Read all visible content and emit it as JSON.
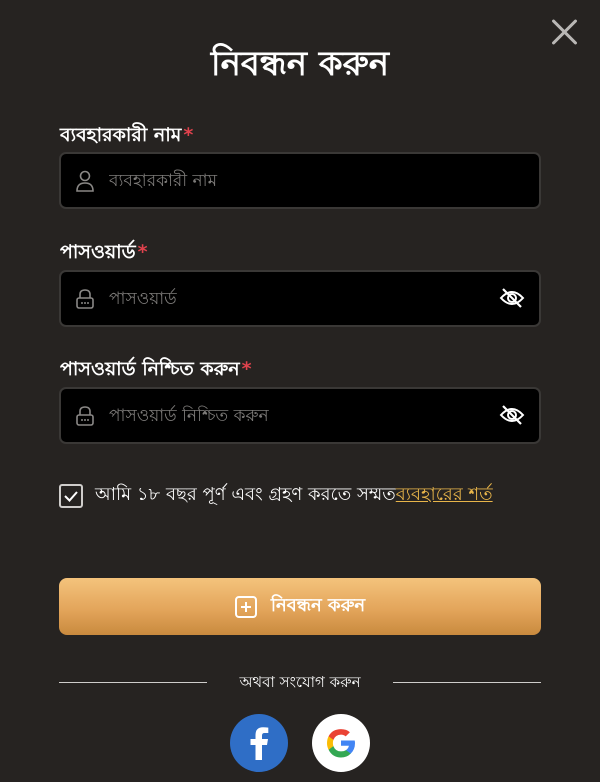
{
  "title": "নিবন্ধন করুন",
  "username": {
    "label": "ব্যবহারকারী নাম",
    "required_mark": "*",
    "placeholder": "ব্যবহারকারী নাম"
  },
  "password": {
    "label": "পাসওয়ার্ড",
    "required_mark": "*",
    "placeholder": "পাসওয়ার্ড"
  },
  "confirm_password": {
    "label": "পাসওয়ার্ড নিশ্চিত করুন",
    "required_mark": "*",
    "placeholder": "পাসওয়ার্ড নিশ্চিত করুন"
  },
  "agreement": {
    "text": "আমি ১৮ বছর পূর্ণ এবং গ্রহণ করতে সম্মত",
    "link": "ব্যবহারের শর্ত",
    "checked": true
  },
  "submit_label": "নিবন্ধন করুন",
  "divider_text": "অথবা সংযোগ করুন",
  "social": [
    "facebook-icon",
    "google-icon"
  ],
  "colors": {
    "background": "#262321",
    "accent": "#e8b54a",
    "required": "#e0424d",
    "button_top": "#f4c37c",
    "button_bottom": "#c98a3e"
  }
}
